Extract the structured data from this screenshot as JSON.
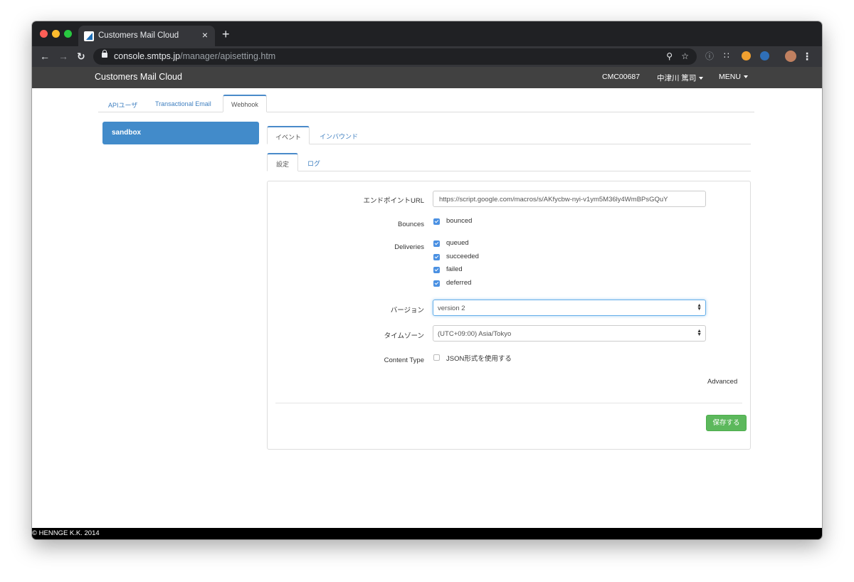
{
  "browser": {
    "tab_title": "Customers Mail Cloud",
    "tab_close": "×",
    "new_tab": "+",
    "url_host": "console.smtps.jp",
    "url_path": "/manager/apisetting.htm"
  },
  "header": {
    "brand": "Customers Mail Cloud",
    "account_id": "CMC00687",
    "user_name": "中津川 篤司",
    "menu_label": "MENU"
  },
  "main_tabs": [
    {
      "label": "APIユーザ"
    },
    {
      "label": "Transactional Email"
    },
    {
      "label": "Webhook"
    }
  ],
  "sidebar": {
    "items": [
      {
        "label": "sandbox"
      }
    ]
  },
  "event_tabs": [
    {
      "label": "イベント"
    },
    {
      "label": "インバウンド"
    }
  ],
  "sub_tabs": [
    {
      "label": "設定"
    },
    {
      "label": "ログ"
    }
  ],
  "form": {
    "endpoint_label": "エンドポイントURL",
    "endpoint_value": "https://script.google.com/macros/s/AKfycbw-nyi-v1ym5M36ly4WmBPsGQuY",
    "bounces_label": "Bounces",
    "bounces_options": [
      {
        "label": "bounced",
        "checked": true
      }
    ],
    "deliveries_label": "Deliveries",
    "deliveries_options": [
      {
        "label": "queued",
        "checked": true
      },
      {
        "label": "succeeded",
        "checked": true
      },
      {
        "label": "failed",
        "checked": true
      },
      {
        "label": "deferred",
        "checked": true
      }
    ],
    "version_label": "バージョン",
    "version_value": "version 2",
    "timezone_label": "タイムゾーン",
    "timezone_value": "(UTC+09:00) Asia/Tokyo",
    "content_type_label": "Content Type",
    "content_type_option": {
      "label": "JSON形式を使用する",
      "checked": false
    },
    "advanced_label": "Advanced",
    "save_label": "保存する"
  },
  "footer": {
    "copyright": "© HENNGE K.K. 2014"
  },
  "colors": {
    "primary": "#428bca",
    "success": "#5cb85c",
    "header_bg": "#414141",
    "link": "#3f7fc0"
  }
}
